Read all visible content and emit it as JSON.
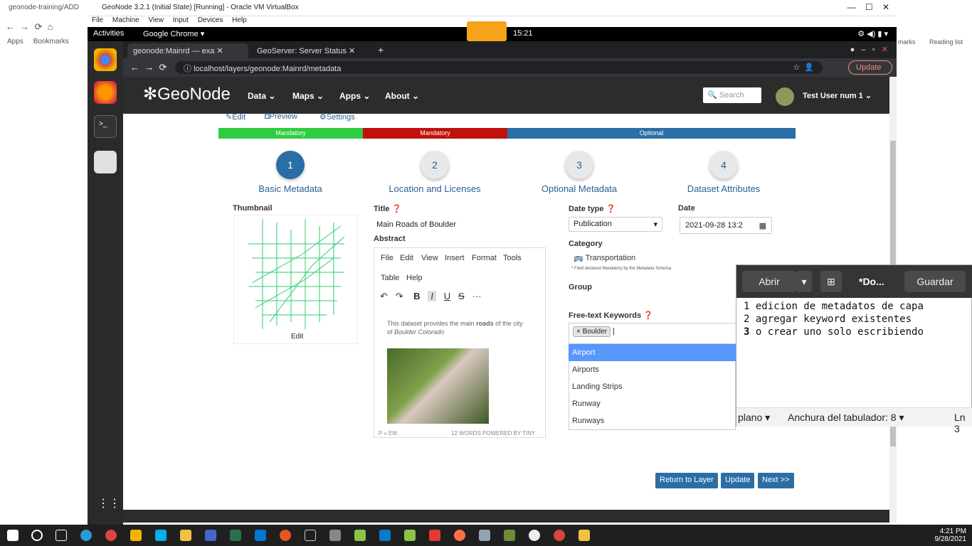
{
  "host": {
    "tab_title": "geonode-training/ADD",
    "bookmarks": [
      "Apps",
      "Bookmarks"
    ],
    "right_bookmarks": [
      "marks",
      "Reading list"
    ]
  },
  "vbox": {
    "title": "GeoNode 3.2.1 (Initial State) [Running] - Oracle VM VirtualBox",
    "menu": [
      "File",
      "Machine",
      "View",
      "Input",
      "Devices",
      "Help"
    ]
  },
  "gnome": {
    "activities": "Activities",
    "app": "Google Chrome ▾",
    "time": "15:21"
  },
  "chrome": {
    "tabs": [
      "geonode:Mainrd — exa",
      "GeoServer: Server Status"
    ],
    "url": "localhost/layers/geonode:Mainrd/metadata",
    "update_label": "Update"
  },
  "geonode": {
    "logo": "GeoNode",
    "nav": [
      "Data",
      "Maps",
      "Apps",
      "About"
    ],
    "search_placeholder": "Search",
    "user": "Test User num 1"
  },
  "page": {
    "sub_links": [
      "Edit",
      "Preview",
      "Settings"
    ],
    "progress": [
      {
        "label": "Mandatory",
        "color": "#2ecc40"
      },
      {
        "label": "Mandatory",
        "color": "#c0110b"
      },
      {
        "label": "Optional",
        "color": "#2b6ea6"
      }
    ],
    "steps": [
      {
        "num": "1",
        "label": "Basic Metadata"
      },
      {
        "num": "2",
        "label": "Location and Licenses"
      },
      {
        "num": "3",
        "label": "Optional Metadata"
      },
      {
        "num": "4",
        "label": "Dataset Attributes"
      }
    ],
    "thumbnail_label": "Thumbnail",
    "thumbnail_edit": "Edit",
    "title_label": "Title",
    "title_value": "Main Roads of Boulder",
    "abstract_label": "Abstract",
    "editor_menu": [
      "File",
      "Edit",
      "View",
      "Insert",
      "Format",
      "Tools",
      "Table",
      "Help"
    ],
    "abstract_text_a": "This dataset provides the main ",
    "abstract_text_b": "roads",
    "abstract_text_c": " of the city of ",
    "abstract_text_d": "Boulder Colorado",
    "editor_status_left": "P » EM",
    "editor_status_right": "12 WORDS  POWERED BY TINY",
    "date_type_label": "Date type",
    "date_type_value": "Publication",
    "date_label": "Date",
    "date_value": "2021-09-28 13:2",
    "category_label": "Category",
    "category_value": "Transportation",
    "category_note": "* Field declared Mandatory by the Metadata Schema",
    "group_label": "Group",
    "keywords_label": "Free-text Keywords",
    "keyword_tag": "Boulder",
    "suggestions": [
      "Airport",
      "Airports",
      "Landing Strips",
      "Runway",
      "Runways"
    ],
    "buttons": [
      "Return to Layer",
      "Update",
      "Next >>"
    ]
  },
  "gedit": {
    "open": "Abrir",
    "doc": "*Do...",
    "save": "Guardar",
    "lines": [
      {
        "n": "1",
        "text": "edicion de metadatos de capa"
      },
      {
        "n": "2",
        "text": "agregar keyword existentes"
      },
      {
        "n": "3",
        "text": "o crear uno solo escribiendo"
      }
    ],
    "footer_mode": "plano",
    "footer_tab": "Anchura del tabulador: 8",
    "footer_ln": "Ln 3"
  },
  "taskbar": {
    "time": "4:21 PM",
    "date": "9/28/2021"
  }
}
